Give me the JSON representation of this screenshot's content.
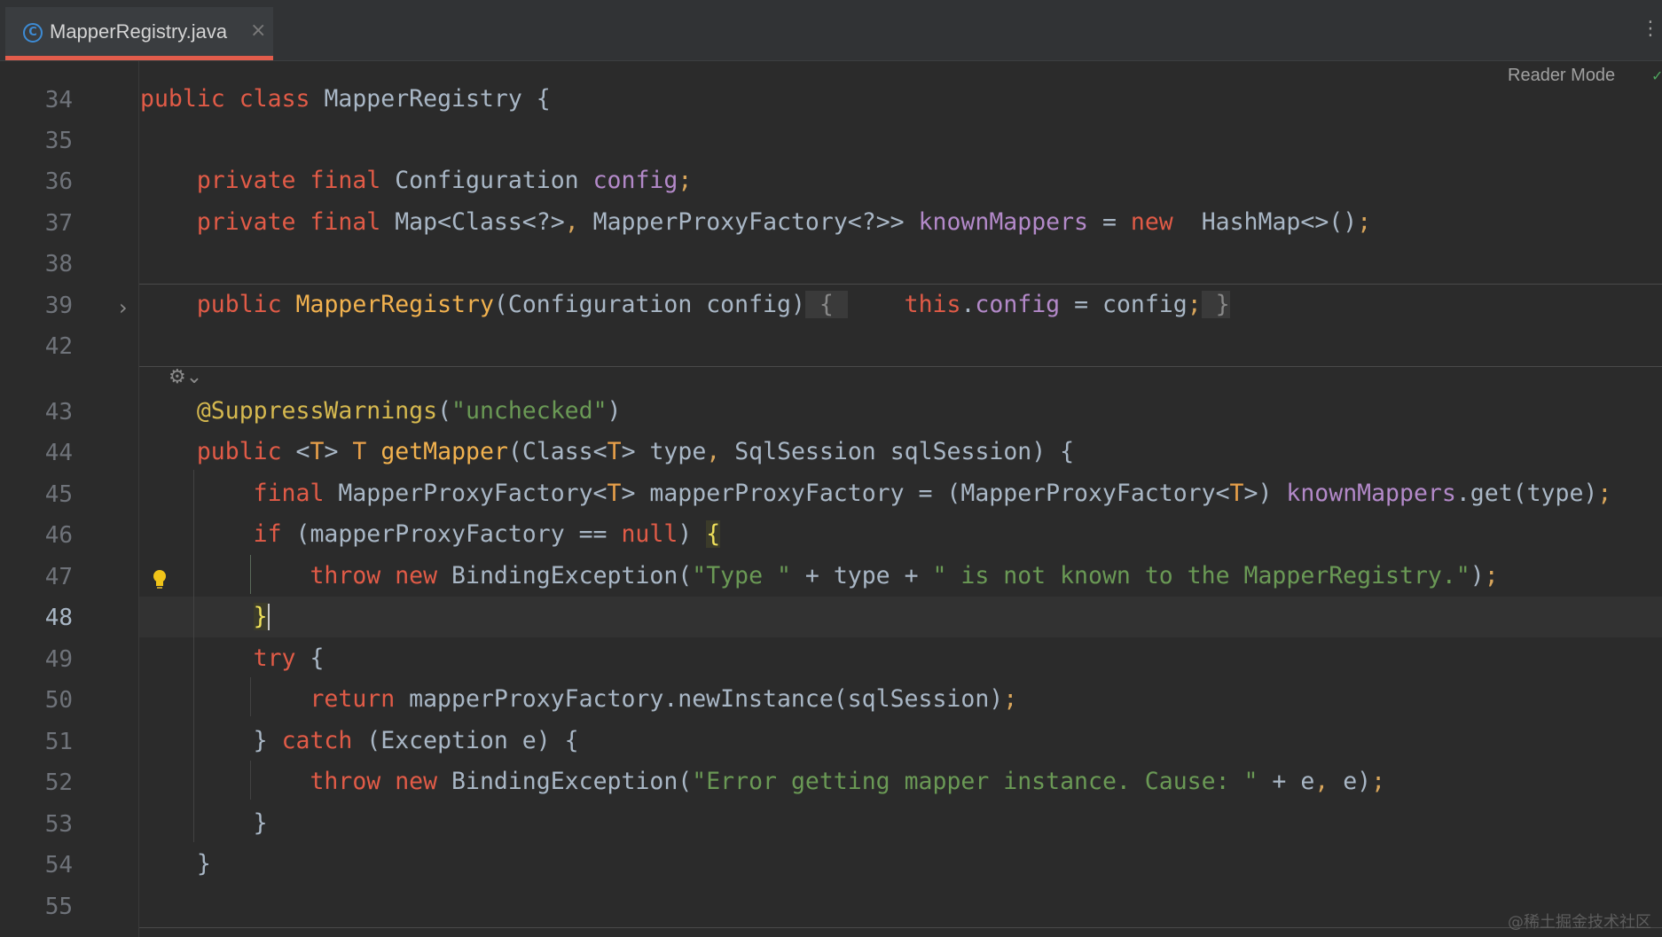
{
  "tab": {
    "title": "MapperRegistry.java",
    "icon": "java-class-icon",
    "close": "×"
  },
  "toolbar": {
    "more": "⋮",
    "reader_mode": "Reader Mode",
    "check": "✓"
  },
  "gutter": {
    "line_numbers": [
      "34",
      "35",
      "36",
      "37",
      "38",
      "39",
      "42",
      "43",
      "44",
      "45",
      "46",
      "47",
      "48",
      "49",
      "50",
      "51",
      "52",
      "53",
      "54",
      "55"
    ],
    "active_line": "48",
    "fold": "›",
    "inlay_icon": "⚙⌄"
  },
  "code": {
    "l34": {
      "a": "public",
      "b": "class",
      "c": " MapperRegistry {"
    },
    "l36": {
      "a": "private",
      "b": "final",
      "c": " Configuration ",
      "d": "config",
      ";": ";"
    },
    "l37": {
      "a": "private",
      "b": "final",
      "c": " Map<Class<?>",
      ",": ",",
      "d": " MapperProxyFactory<?>> ",
      "e": "knownMappers",
      "f": " = ",
      "g": "new",
      "h": " HashMap<>()",
      ";": ";"
    },
    "l39": {
      "a": "public",
      "b": "MapperRegistry",
      "c": "(Configuration config)",
      "d": " { ",
      "e": "this",
      "f": ".",
      "g": "config",
      "h": " = config",
      "i": ";",
      "j": " }"
    },
    "l43": {
      "a": "@SuppressWarnings",
      "b": "(",
      "c": "\"unchecked\"",
      "d": ")"
    },
    "l44": {
      "a": "public",
      "b": " <",
      "c": "T",
      "d": "> ",
      "e": "T",
      "f": " ",
      "g": "getMapper",
      "h": "(Class<",
      "i": "T",
      "j": "> type",
      ",": ",",
      "k": " SqlSession sqlSession) {"
    },
    "l45": {
      "a": "final",
      "b": " MapperProxyFactory<",
      "c": "T",
      "d": "> mapperProxyFactory = (MapperProxyFactory<",
      "e": "T",
      "f": ">) ",
      "g": "knownMappers",
      "h": ".get(type)",
      ";": ";"
    },
    "l46": {
      "a": "if",
      "b": " (mapperProxyFactory == ",
      "c": "null",
      "d": ") ",
      "e": "{"
    },
    "l47": {
      "a": "throw",
      "b": "new",
      "c": " BindingException(",
      "d": "\"Type \"",
      "e": " + type + ",
      "f": "\" is not known to the MapperRegistry.\"",
      "g": ")",
      ";": ";"
    },
    "l48": {
      "a": "}"
    },
    "l49": {
      "a": "try",
      "b": " {"
    },
    "l50": {
      "a": "return",
      "b": " mapperProxyFactory.newInstance(sqlSession)",
      ";": ";"
    },
    "l51": {
      "a": "} ",
      "b": "catch",
      "c": " (Exception e) {"
    },
    "l52": {
      "a": "throw",
      "b": "new",
      "c": " BindingException(",
      "d": "\"Error getting mapper instance. Cause: \"",
      "e": " + e",
      ",": ",",
      "f": " e)",
      ";": ";"
    },
    "l53": {
      "a": "}"
    },
    "l54": {
      "a": "}"
    }
  },
  "watermark": "@稀土掘金技术社区",
  "colors": {
    "keyword": "#e15b47",
    "function": "#f2b24f",
    "field": "#b389c9",
    "string": "#6a9955",
    "annotation": "#d6b94f",
    "tab_accent": "#e25c4b"
  }
}
